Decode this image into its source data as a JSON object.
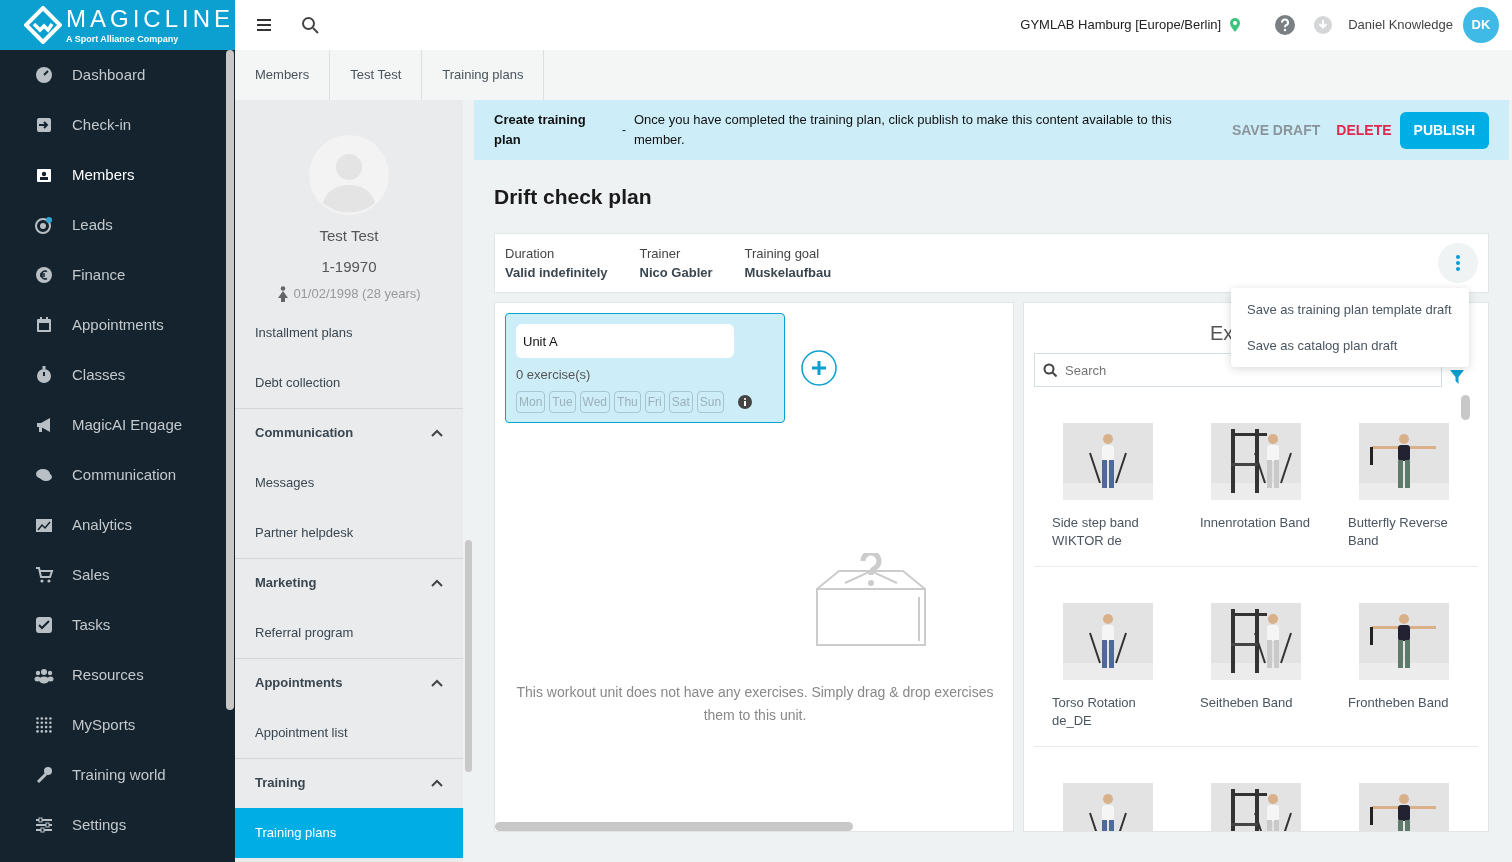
{
  "brand": {
    "name": "MAGICLINE",
    "tagline": "A Sport Alliance Company"
  },
  "nav": [
    {
      "label": "Dashboard",
      "selected": false
    },
    {
      "label": "Check-in",
      "selected": false
    },
    {
      "label": "Members",
      "selected": true
    },
    {
      "label": "Leads",
      "selected": false
    },
    {
      "label": "Finance",
      "selected": false
    },
    {
      "label": "Appointments",
      "selected": false
    },
    {
      "label": "Classes",
      "selected": false
    },
    {
      "label": "MagicAI Engage",
      "selected": false
    },
    {
      "label": "Communication",
      "selected": false
    },
    {
      "label": "Analytics",
      "selected": false
    },
    {
      "label": "Sales",
      "selected": false
    },
    {
      "label": "Tasks",
      "selected": false
    },
    {
      "label": "Resources",
      "selected": false
    },
    {
      "label": "MySports",
      "selected": false
    },
    {
      "label": "Training world",
      "selected": false
    },
    {
      "label": "Settings",
      "selected": false
    }
  ],
  "topbar": {
    "location": "GYMLAB Hamburg [Europe/Berlin]",
    "user": "Daniel Knowledge",
    "initials": "DK"
  },
  "breadcrumbs": [
    "Members",
    "Test Test",
    "Training plans"
  ],
  "member": {
    "name": "Test Test",
    "number": "1-19970",
    "birth": "01/02/1998 (28 years)"
  },
  "member_menu": [
    {
      "kind": "item",
      "label": "Installment plans",
      "selected": false
    },
    {
      "kind": "item",
      "label": "Debt collection",
      "selected": false
    },
    {
      "kind": "section",
      "label": "Communication",
      "expanded": true,
      "children": [
        {
          "kind": "item",
          "label": "Messages",
          "selected": false
        },
        {
          "kind": "item",
          "label": "Partner helpdesk",
          "selected": false
        }
      ]
    },
    {
      "kind": "section",
      "label": "Marketing",
      "expanded": true,
      "children": [
        {
          "kind": "item",
          "label": "Referral program",
          "selected": false
        }
      ]
    },
    {
      "kind": "section",
      "label": "Appointments",
      "expanded": true,
      "children": [
        {
          "kind": "item",
          "label": "Appointment list",
          "selected": false
        }
      ]
    },
    {
      "kind": "section",
      "label": "Training",
      "expanded": true,
      "children": [
        {
          "kind": "item",
          "label": "Training plans",
          "selected": true
        }
      ]
    }
  ],
  "banner": {
    "title": "Create training plan",
    "separator": "-",
    "message": "Once you have completed the training plan, click publish to make this content available to this member.",
    "buttons": [
      {
        "kind": "text",
        "label": "SAVE DRAFT",
        "disabled": true
      },
      {
        "kind": "danger",
        "label": "DELETE",
        "disabled": false
      },
      {
        "kind": "primary",
        "label": "PUBLISH",
        "disabled": false
      }
    ]
  },
  "plan": {
    "title": "Drift check plan",
    "info": [
      {
        "label": "Duration",
        "value": "Valid indefinitely"
      },
      {
        "label": "Trainer",
        "value": "Nico Gabler"
      },
      {
        "label": "Training goal",
        "value": "Muskelaufbau"
      }
    ],
    "menu": [
      "Save as training plan template draft",
      "Save as catalog plan draft"
    ]
  },
  "unit": {
    "name": "Unit A",
    "count": "0 exercise(s)",
    "days": [
      {
        "label": "Mon",
        "selected": false
      },
      {
        "label": "Tue",
        "selected": false
      },
      {
        "label": "Wed",
        "selected": false
      },
      {
        "label": "Thu",
        "selected": false
      },
      {
        "label": "Fri",
        "selected": false
      },
      {
        "label": "Sat",
        "selected": false
      },
      {
        "label": "Sun",
        "selected": false
      }
    ]
  },
  "empty_message": "This workout unit does not have any exercises. Simply drag & drop exercises them to this unit.",
  "exercises": {
    "heading": "Ex",
    "search": {
      "placeholder": "Search"
    },
    "items": [
      {
        "name": "Side step band WIKTOR de"
      },
      {
        "name": "Innenrotation Band"
      },
      {
        "name": "Butterfly Reverse Band"
      },
      {
        "name": "Torso Rotation de_DE"
      },
      {
        "name": "Seitheben Band"
      },
      {
        "name": "Frontheben Band"
      },
      {
        "kind": "picture"
      },
      {
        "kind": "picture"
      },
      {
        "kind": "picture"
      }
    ]
  }
}
